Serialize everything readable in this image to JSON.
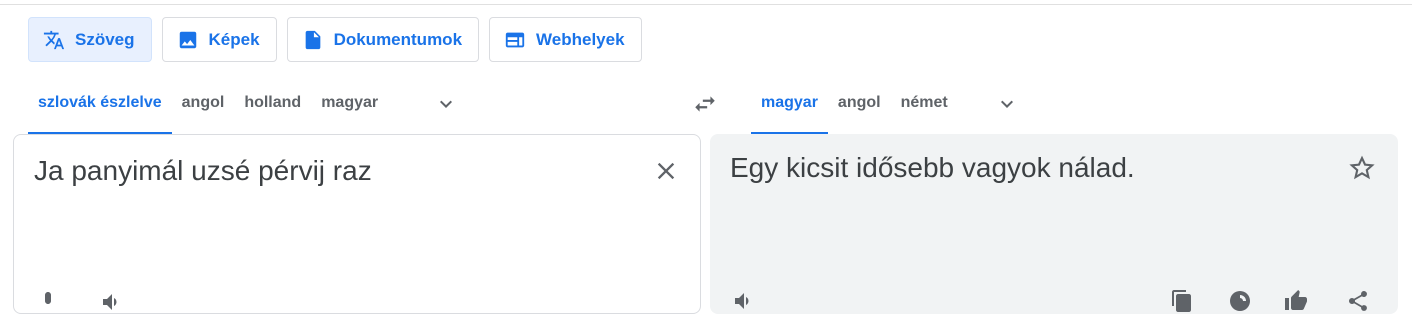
{
  "mode_tabs": [
    {
      "label": "Szöveg",
      "icon": "translate-icon",
      "active": true
    },
    {
      "label": "Képek",
      "icon": "image-icon",
      "active": false
    },
    {
      "label": "Dokumentumok",
      "icon": "document-icon",
      "active": false
    },
    {
      "label": "Webhelyek",
      "icon": "website-icon",
      "active": false
    }
  ],
  "source_languages": [
    {
      "label": "szlovák észlelve",
      "selected": true
    },
    {
      "label": "angol",
      "selected": false
    },
    {
      "label": "holland",
      "selected": false
    },
    {
      "label": "magyar",
      "selected": false
    }
  ],
  "target_languages": [
    {
      "label": "magyar",
      "selected": true
    },
    {
      "label": "angol",
      "selected": false
    },
    {
      "label": "német",
      "selected": false
    }
  ],
  "source": {
    "text": "Ja panyimál uzsé pérvij raz"
  },
  "target": {
    "text": "Egy kicsit idősebb vagyok nálad."
  },
  "colors": {
    "accent": "#1a73e8",
    "active_tab_bg": "#e8f0fe",
    "target_panel_bg": "#f1f3f4",
    "text": "#3c4043"
  }
}
